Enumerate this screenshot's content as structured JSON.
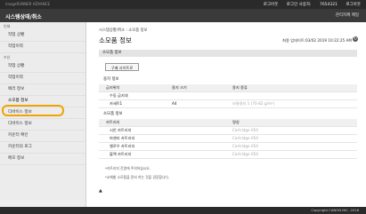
{
  "header": {
    "logo": "imageRUNNER ADVANCE",
    "right_items": [
      "로그아웃",
      "로그인 사용자:",
      "7654321",
      "로그아웃"
    ],
    "app_title": "시스템상태/취소",
    "admin_link": "관리자께 메일"
  },
  "sidebar": {
    "section1": "인쇄",
    "items1": [
      "작업 상황",
      "작업이력"
    ],
    "section2": "수신",
    "items2": [
      "작업 상황",
      "작업이력",
      "에러 정보",
      "소모품 정보",
      "디바이스 정보",
      "디바이스 정보",
      "카운터 확인",
      "카운터의 로그",
      "메모 정보"
    ]
  },
  "main": {
    "breadcrumb": "시스템상황/취소 : 소모품 정보",
    "title": "소모품 정보",
    "updated": "최종 업데이트:03/02 2019 10:22:25 AM",
    "refresh_icon": "↻",
    "section_consumables": "소모품 정보",
    "order_button": "구매 사이트로",
    "paper_info_header": "용지 정보",
    "paper_columns": [
      "급지위치",
      "용지 크기",
      "용지 종류"
    ],
    "paper_rows": [
      [
        "수동 급지대",
        "",
        ""
      ],
      [
        "카세트1",
        "A4",
        "보통용지 1 (70-82 g/m²)"
      ]
    ],
    "cartridge_header": "소모품 정보",
    "cartridge_columns": [
      "카트리지",
      "명칭"
    ],
    "cartridge_rows": [
      [
        "시안 카트리지",
        "Cartridge 054"
      ],
      [
        "마젠타 카트리지",
        "Cartridge 054"
      ],
      [
        "옐로우 카트리지",
        "Cartridge 054"
      ],
      [
        "블랙 카트리지",
        "Cartridge 054"
      ]
    ],
    "note1": "*카트리지 잔량에 주의하십시오.",
    "note2": "*교체할 소모품을 준비 하는 것을 권장합니다.",
    "to_top": "▲"
  },
  "footer": {
    "copyright": "Copyright CANON INC. 2018"
  }
}
